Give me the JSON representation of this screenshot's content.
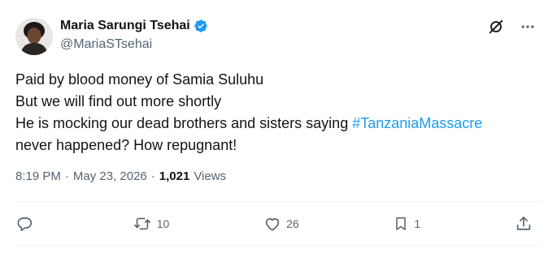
{
  "author": {
    "display_name": "Maria Sarungi Tsehai",
    "handle": "@MariaSTsehai"
  },
  "tweet": {
    "lines": [
      "Paid by blood money of Samia Suluhu",
      "But we will find out more shortly",
      "He is mocking our dead brothers and sisters saying "
    ],
    "hashtag": "#TanzaniaMassacre",
    "line4": "never happened? How repugnant!"
  },
  "meta": {
    "time": "8:19 PM",
    "separator": "·",
    "date": "May 23, 2026",
    "views_count": "1,021",
    "views_label": "Views"
  },
  "actions": {
    "reply_count": "",
    "retweet_count": "10",
    "like_count": "26",
    "bookmark_count": "1"
  },
  "colors": {
    "accent": "#1d9bf0",
    "text": "#0f1419",
    "muted": "#536471",
    "border": "#eff3f4"
  },
  "icons": [
    "verified-badge-icon",
    "grok-icon",
    "more-icon",
    "reply-icon",
    "retweet-icon",
    "like-icon",
    "bookmark-icon",
    "share-icon"
  ]
}
